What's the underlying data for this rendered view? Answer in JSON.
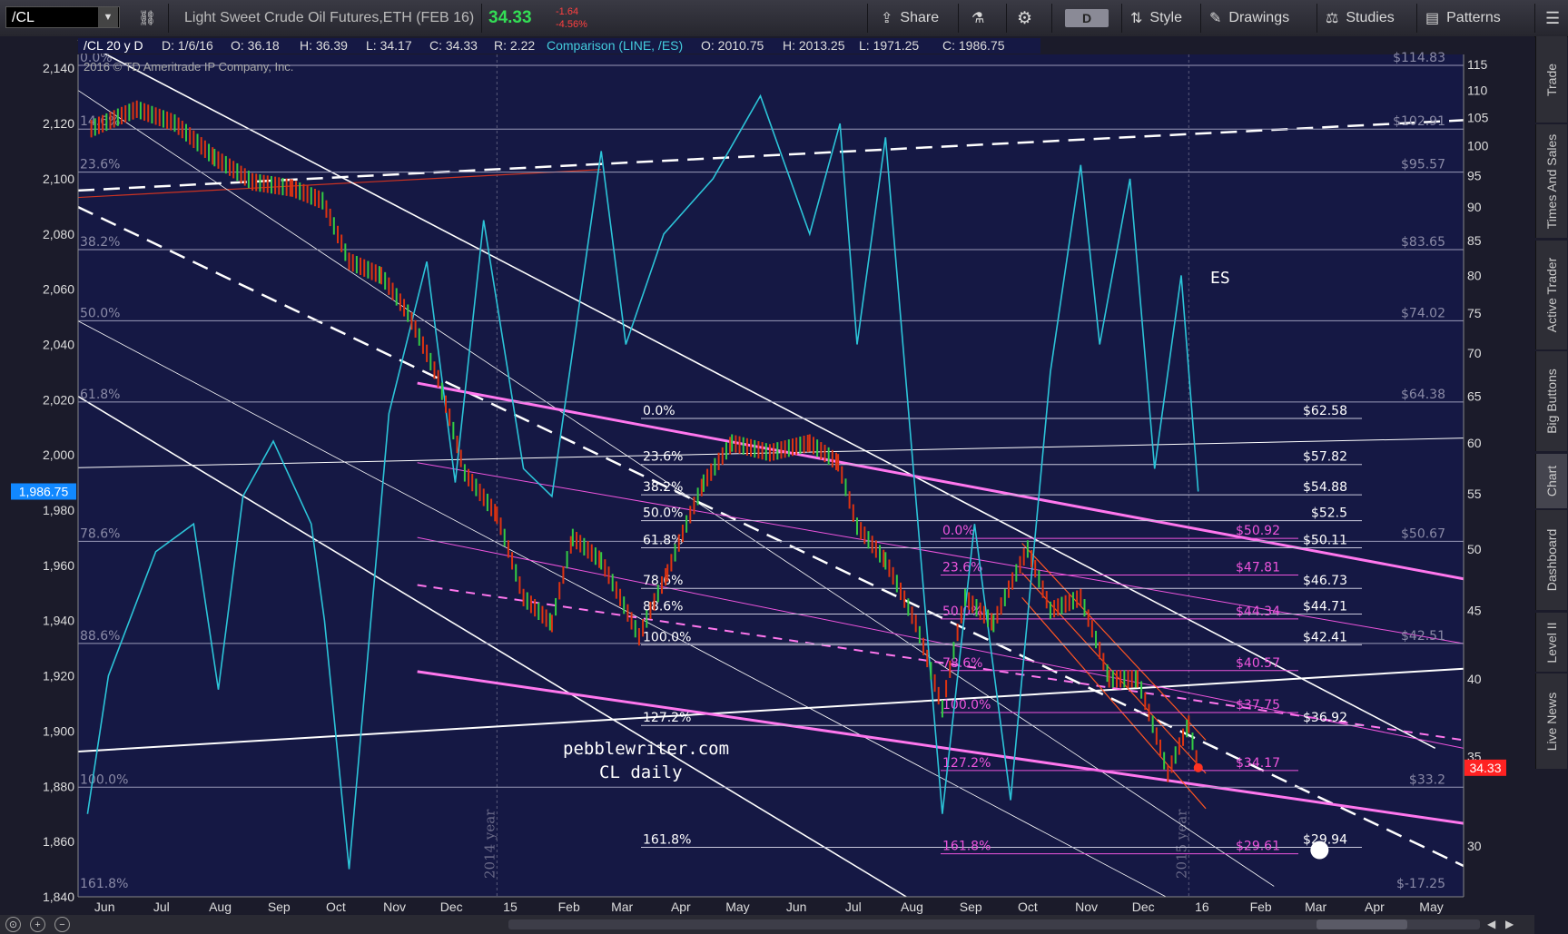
{
  "toolbar": {
    "symbol": "/CL",
    "description": "Light Sweet Crude Oil Futures,ETH (FEB 16)",
    "last": "34.33",
    "change": "-1.64",
    "change_pct": "-4.56%",
    "share": "Share",
    "period": "D",
    "style": "Style",
    "drawings": "Drawings",
    "studies": "Studies",
    "patterns": "Patterns"
  },
  "side_tabs": [
    "Trade",
    "Times And Sales",
    "Active Trader",
    "Big Buttons",
    "Chart",
    "Dashboard",
    "Level II",
    "Live News"
  ],
  "header": {
    "main": "/CL 20 y D",
    "d": "D: 1/6/16",
    "o": "O: 36.18",
    "h": "H: 36.39",
    "l": "L: 34.17",
    "c": "C: 34.33",
    "r": "R: 2.22",
    "comparison": "Comparison (LINE, /ES)",
    "co": "O: 2010.75",
    "ch": "H: 2013.25",
    "cl": "L: 1971.25",
    "cc": "C: 1986.75"
  },
  "copyright": "2016 © TD Ameritrade IP Company, Inc.",
  "annotations": {
    "site": "pebblewriter.com",
    "chart_name": "CL daily",
    "es_label": "ES",
    "year_2014": "2014 year",
    "year_2015": "2015 year"
  },
  "chart_data": {
    "type": "line",
    "title": "Light Sweet Crude Oil Futures,ETH (FEB 16)",
    "series": [
      {
        "name": "/CL",
        "style": "candlestick",
        "color": "#dd3311",
        "points": [
          [
            "2014-06-01",
            103
          ],
          [
            "2014-06-25",
            106.5
          ],
          [
            "2014-07-15",
            104
          ],
          [
            "2014-08-05",
            98
          ],
          [
            "2014-08-25",
            94
          ],
          [
            "2014-09-15",
            93
          ],
          [
            "2014-10-01",
            91
          ],
          [
            "2014-10-15",
            82
          ],
          [
            "2014-11-01",
            80
          ],
          [
            "2014-11-15",
            75
          ],
          [
            "2014-12-01",
            67
          ],
          [
            "2014-12-15",
            57
          ],
          [
            "2015-01-01",
            53
          ],
          [
            "2015-01-15",
            46
          ],
          [
            "2015-01-30",
            44
          ],
          [
            "2015-02-10",
            51
          ],
          [
            "2015-02-25",
            49
          ],
          [
            "2015-03-17",
            43
          ],
          [
            "2015-04-01",
            48
          ],
          [
            "2015-04-20",
            56
          ],
          [
            "2015-05-05",
            60
          ],
          [
            "2015-05-25",
            59
          ],
          [
            "2015-06-15",
            60
          ],
          [
            "2015-06-30",
            58
          ],
          [
            "2015-07-10",
            52
          ],
          [
            "2015-07-25",
            49
          ],
          [
            "2015-08-10",
            44
          ],
          [
            "2015-08-24",
            38
          ],
          [
            "2015-09-05",
            46
          ],
          [
            "2015-09-20",
            44
          ],
          [
            "2015-10-08",
            50
          ],
          [
            "2015-10-20",
            45
          ],
          [
            "2015-11-05",
            46
          ],
          [
            "2015-11-20",
            40
          ],
          [
            "2015-12-05",
            40
          ],
          [
            "2015-12-21",
            34
          ],
          [
            "2016-01-01",
            37
          ],
          [
            "2016-01-06",
            34.33
          ]
        ]
      },
      {
        "name": "/ES",
        "style": "line",
        "color": "#2cc4d8",
        "points": [
          [
            "2014-05-30",
            1870
          ],
          [
            "2014-06-10",
            1920
          ],
          [
            "2014-07-05",
            1965
          ],
          [
            "2014-07-25",
            1975
          ],
          [
            "2014-08-07",
            1915
          ],
          [
            "2014-08-20",
            1985
          ],
          [
            "2014-09-05",
            2005
          ],
          [
            "2014-09-25",
            1975
          ],
          [
            "2014-10-02",
            1940
          ],
          [
            "2014-10-15",
            1850
          ],
          [
            "2014-11-05",
            2015
          ],
          [
            "2014-11-25",
            2070
          ],
          [
            "2014-12-10",
            1990
          ],
          [
            "2014-12-25",
            2085
          ],
          [
            "2015-01-15",
            1995
          ],
          [
            "2015-01-30",
            1985
          ],
          [
            "2015-02-25",
            2110
          ],
          [
            "2015-03-10",
            2040
          ],
          [
            "2015-03-30",
            2080
          ],
          [
            "2015-04-25",
            2100
          ],
          [
            "2015-05-20",
            2130
          ],
          [
            "2015-06-15",
            2080
          ],
          [
            "2015-07-01",
            2120
          ],
          [
            "2015-07-10",
            2040
          ],
          [
            "2015-07-25",
            2115
          ],
          [
            "2015-08-24",
            1870
          ],
          [
            "2015-09-10",
            1975
          ],
          [
            "2015-09-29",
            1875
          ],
          [
            "2015-10-20",
            2030
          ],
          [
            "2015-11-05",
            2105
          ],
          [
            "2015-11-15",
            2040
          ],
          [
            "2015-12-01",
            2100
          ],
          [
            "2015-12-14",
            1995
          ],
          [
            "2015-12-28",
            2065
          ],
          [
            "2016-01-06",
            1986.75
          ]
        ]
      }
    ],
    "left_axis": {
      "range": [
        1840,
        2145
      ],
      "ticks": [
        2140,
        2120,
        2100,
        2080,
        2060,
        2040,
        2020,
        2000,
        1980,
        1960,
        1940,
        1920,
        1900,
        1880,
        1860,
        1840
      ],
      "current": "1,986.75"
    },
    "right_axis": {
      "scale": "log",
      "range": [
        27.5,
        117
      ],
      "ticks": [
        115,
        110,
        105,
        100,
        95,
        90,
        85,
        80,
        75,
        70,
        65,
        60,
        55,
        50,
        45,
        40,
        35,
        30
      ],
      "current": "34.33"
    },
    "x_labels": [
      "Jun",
      "Jul",
      "Aug",
      "Sep",
      "Oct",
      "Nov",
      "Dec",
      "15",
      "Feb",
      "Mar",
      "Apr",
      "May",
      "Jun",
      "Jul",
      "Aug",
      "Sep",
      "Oct",
      "Nov",
      "Dec",
      "16",
      "Feb",
      "Mar",
      "Apr",
      "May"
    ],
    "x_range": [
      "2014-05-25",
      "2016-05-25"
    ],
    "year_marks": [
      "2015-01-01",
      "2016-01-01"
    ],
    "fib_big": [
      {
        "label": "0.0%",
        "price": 114.83,
        "tag": "$114.83"
      },
      {
        "label": "14.6%",
        "price": 102.91,
        "tag": "$102.91"
      },
      {
        "label": "23.6%",
        "price": 95.57,
        "tag": "$95.57"
      },
      {
        "label": "38.2%",
        "price": 83.65,
        "tag": "$83.65"
      },
      {
        "label": "50.0%",
        "price": 74.02,
        "tag": "$74.02"
      },
      {
        "label": "61.8%",
        "price": 64.38,
        "tag": "$64.38"
      },
      {
        "label": "78.6%",
        "price": 50.67,
        "tag": "$50.67"
      },
      {
        "label": "88.6%",
        "price": 42.51,
        "tag": "$42.51"
      },
      {
        "label": "100.0%",
        "price": 33.2,
        "tag": "$33.2"
      },
      {
        "label": "161.8%",
        "price": -17.25,
        "tag": "$-17.25"
      }
    ],
    "fib_mid": [
      {
        "label": "0.0%",
        "price": 62.58,
        "tag": "$62.58"
      },
      {
        "label": "23.6%",
        "price": 57.82,
        "tag": "$57.82"
      },
      {
        "label": "38.2%",
        "price": 54.88,
        "tag": "$54.88"
      },
      {
        "label": "50.0%",
        "price": 52.5,
        "tag": "$52.5"
      },
      {
        "label": "61.8%",
        "price": 50.11,
        "tag": "$50.11"
      },
      {
        "label": "78.6%",
        "price": 46.73,
        "tag": "$46.73"
      },
      {
        "label": "88.6%",
        "price": 44.71,
        "tag": "$44.71"
      },
      {
        "label": "100.0%",
        "price": 42.41,
        "tag": "$42.41"
      },
      {
        "label": "127.2%",
        "price": 36.92,
        "tag": "$36.92"
      },
      {
        "label": "161.8%",
        "price": 29.94,
        "tag": "$29.94"
      }
    ],
    "fib_small": [
      {
        "label": "0.0%",
        "price": 50.92,
        "tag": "$50.92"
      },
      {
        "label": "23.6%",
        "price": 47.81,
        "tag": "$47.81"
      },
      {
        "label": "50.0%",
        "price": 44.34,
        "tag": "$44.34"
      },
      {
        "label": "78.6%",
        "price": 40.57,
        "tag": "$40.57"
      },
      {
        "label": "100.0%",
        "price": 37.75,
        "tag": "$37.75"
      },
      {
        "label": "127.2%",
        "price": 34.17,
        "tag": "$34.17"
      },
      {
        "label": "161.8%",
        "price": 29.61,
        "tag": "$29.61"
      }
    ],
    "colors": {
      "background": "#151844",
      "candle": "#dd3311",
      "compare": "#2cc4d8",
      "fib_small": "#ee55dd",
      "channel_pink": "#ff77ee",
      "last_tag": "#ff2222",
      "es_tag": "#1188ff"
    }
  }
}
